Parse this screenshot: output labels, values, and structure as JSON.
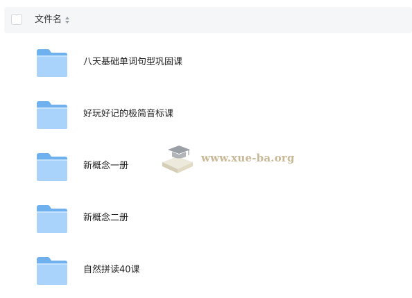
{
  "header": {
    "column_title": "文件名"
  },
  "files": [
    {
      "name": "八天基础单词句型巩固课",
      "icon": "folder-icon"
    },
    {
      "name": "好玩好记的极简音标课",
      "icon": "folder-icon"
    },
    {
      "name": "新概念一册",
      "icon": "folder-icon"
    },
    {
      "name": "新概念二册",
      "icon": "folder-icon"
    },
    {
      "name": "自然拼读40课",
      "icon": "folder-icon"
    }
  ],
  "watermark": {
    "text": "www.xue-ba.org"
  },
  "colors": {
    "header_bg": "#f5f6f8",
    "folder_light": "#a9d3fb",
    "folder_dark": "#6fb1ef",
    "watermark": "#c8b896"
  }
}
